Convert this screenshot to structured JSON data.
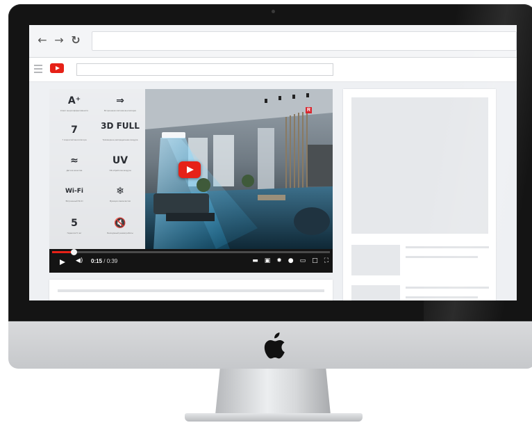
{
  "device": {
    "type": "desktop-monitor",
    "logo_icon": "apple-logo-icon"
  },
  "browser": {
    "back_icon": "←",
    "forward_icon": "→",
    "reload_icon": "↻",
    "address_value": ""
  },
  "youtube": {
    "menu_icon": "hamburger-icon",
    "logo_icon": "youtube-logo-icon",
    "search_value": ""
  },
  "video": {
    "brand_badge": "R",
    "features": [
      {
        "icon": "A⁺",
        "label": "Класс энергоэффективности"
      },
      {
        "icon": "⇒",
        "label": "Встроенная система вентиляции"
      },
      {
        "icon": "7",
        "label": "7 скоростей вентилятора"
      },
      {
        "icon": "3D FULL",
        "label": "Трёхмерное распределение воздуха"
      },
      {
        "icon": "≈",
        "label": "Датчик качества"
      },
      {
        "icon": "UV",
        "label": "УФ-обработка воздуха"
      },
      {
        "icon": "Wi-Fi",
        "label": "Встроенный Wi-Fi"
      },
      {
        "icon": "❄",
        "label": "Функция самоочистки"
      },
      {
        "icon": "5",
        "label": "Гарантия 5 лет"
      },
      {
        "icon": "🔇",
        "label": "Бесшумный режим работы"
      }
    ],
    "progress_fraction": 0.077,
    "current_time": "0:15",
    "duration": "0:39",
    "time_separator": " / ",
    "control_icons": [
      "subtitles-icon",
      "cc-icon",
      "settings-icon",
      "info-icon",
      "miniplayer-icon",
      "theater-icon",
      "fullscreen-icon"
    ]
  }
}
